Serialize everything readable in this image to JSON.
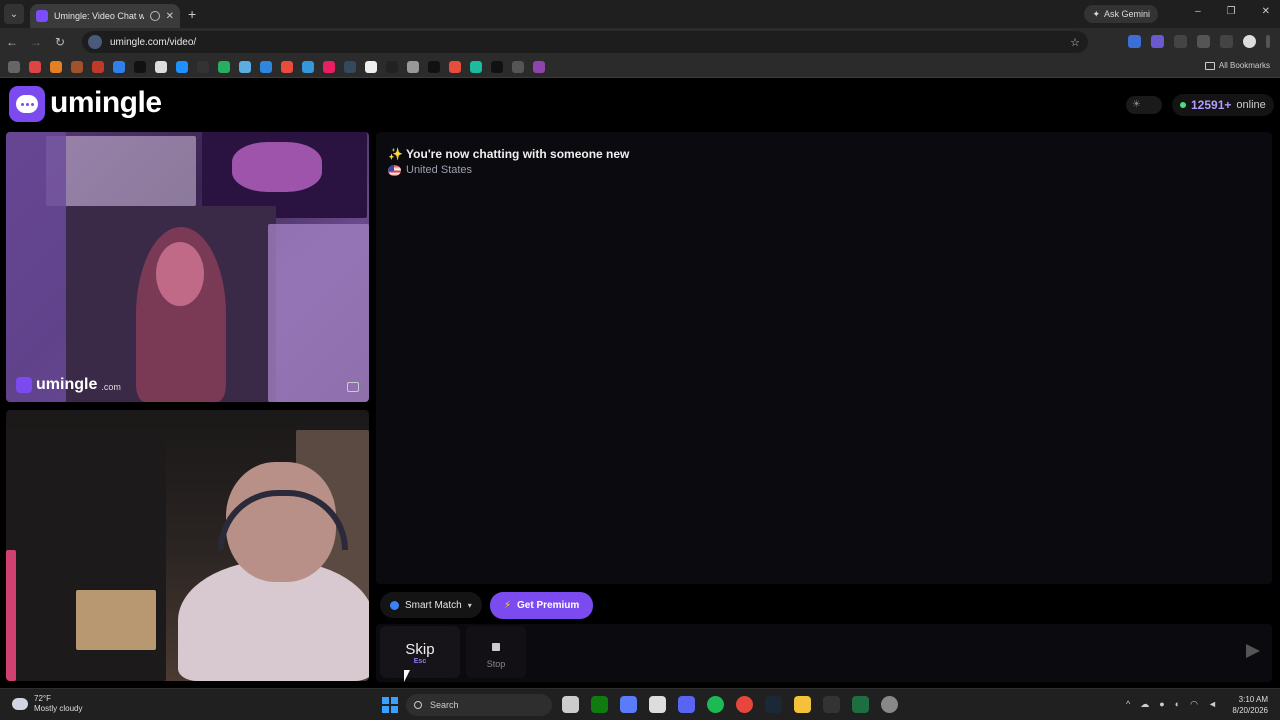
{
  "browser": {
    "tab_title": "Umingle: Video Chat with St...",
    "url": "umingle.com/video/",
    "gemini_label": "Ask Gemini",
    "all_bookmarks": "All Bookmarks",
    "minimize": "–",
    "restore": "❐",
    "close": "✕",
    "new_tab": "+",
    "back": "←",
    "forward": "→",
    "reload": "↻",
    "star": "☆",
    "tab_close": "✕",
    "tab_menu": "⌄"
  },
  "site": {
    "logo_text": "umingle",
    "online_count": "12591+",
    "online_label": "online",
    "theme_icon": "☀"
  },
  "video": {
    "watermark_text": "umingle",
    "watermark_domain": ".com"
  },
  "chat": {
    "message": "✨ You're now chatting with someone new",
    "location": "United States"
  },
  "controls": {
    "smart_match": "Smart Match",
    "smart_caret": "▾",
    "premium": "Get Premium",
    "premium_icon": "⚡",
    "skip": "Skip",
    "skip_key": "Esc",
    "stop": "Stop",
    "input_placeholder": ""
  },
  "taskbar": {
    "weather_temp": "72°F",
    "weather_desc": "Mostly cloudy",
    "search": "Search",
    "time": "3:10 AM",
    "date": "8/20/2026"
  },
  "colors": {
    "accent": "#7b4bf0",
    "online": "#4ade80"
  }
}
